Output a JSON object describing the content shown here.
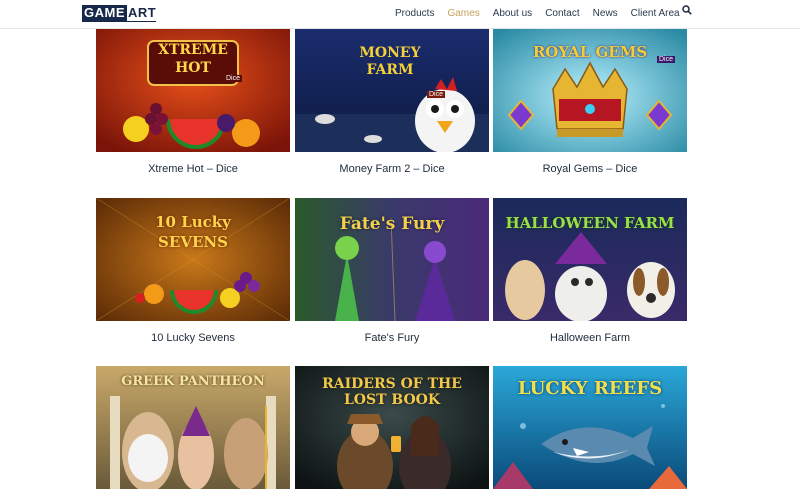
{
  "header": {
    "logo": {
      "part1": "GAME",
      "part2": "ART"
    },
    "nav": [
      {
        "label": "Products",
        "active": false
      },
      {
        "label": "Games",
        "active": true
      },
      {
        "label": "About us",
        "active": false
      },
      {
        "label": "Contact",
        "active": false
      },
      {
        "label": "News",
        "active": false
      },
      {
        "label": "Client Area",
        "active": false
      }
    ],
    "search_icon": "search-icon"
  },
  "colors": {
    "nav_active": "#c9a25c",
    "logo": "#17284a"
  },
  "games": [
    {
      "title": "Xtreme Hot – Dice",
      "art_text": "XTREME HOT",
      "art_badge": "Dice"
    },
    {
      "title": "Money Farm 2 – Dice",
      "art_text": "MONEY FARM",
      "art_badge": "Dice"
    },
    {
      "title": "Royal Gems – Dice",
      "art_text": "ROYAL GEMS",
      "art_badge": "Dice"
    },
    {
      "title": "10 Lucky Sevens",
      "art_text": "10 Lucky SEVENS",
      "art_badge": ""
    },
    {
      "title": "Fate's Fury",
      "art_text": "Fate's Fury",
      "art_badge": ""
    },
    {
      "title": "Halloween Farm",
      "art_text": "HALLOWEEN FARM",
      "art_badge": ""
    },
    {
      "title": "",
      "art_text": "GREEK PANTHEON",
      "art_badge": ""
    },
    {
      "title": "",
      "art_text": "RAIDERS OF THE LOST BOOK",
      "art_badge": ""
    },
    {
      "title": "",
      "art_text": "LUCKY REEFS",
      "art_badge": ""
    }
  ]
}
